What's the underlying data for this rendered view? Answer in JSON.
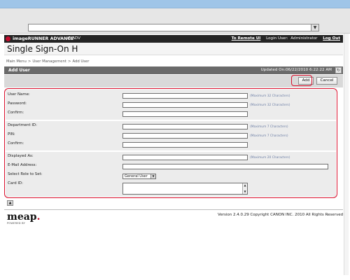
{
  "browser": {
    "address_value": ""
  },
  "brand": {
    "product": "imageRUNNER ADVANCE",
    "model": "iR-ADV",
    "links": [
      "To Remote UI",
      "Login User:",
      "Administrator",
      "Log Out"
    ]
  },
  "page": {
    "title": "Single Sign-On H"
  },
  "breadcrumb": [
    "Main Menu",
    "User Management",
    "Add User"
  ],
  "section": {
    "title": "Add User",
    "updated": "Updated On:06/22/2010 6:22:22 AM"
  },
  "actions": {
    "add": "Add",
    "cancel": "Cancel"
  },
  "form": {
    "user_name_label": "User Name:",
    "password_label": "Password:",
    "confirm_label": "Confirm:",
    "department_id_label": "Department ID:",
    "pin_label": "PIN:",
    "confirm2_label": "Confirm:",
    "displayed_as_label": "Displayed As:",
    "email_label": "E-Mail Address:",
    "role_label": "Select Role to Set:",
    "card_id_label": "Card ID:",
    "hint_32a": "(Maximum 32 Characters)",
    "hint_32b": "(Maximum 32 Characters)",
    "hint_7a": "(Maximum 7 Characters)",
    "hint_7b": "(Maximum 7 Characters)",
    "hint_20": "(Maximum 20 Characters)",
    "role_selected": "General User"
  },
  "footer": {
    "meap": "meap",
    "meap_sub": "POWERED BY",
    "copyright": "Version 2.4.0.29 Copyright CANON INC. 2010 All Rights Reserved"
  }
}
